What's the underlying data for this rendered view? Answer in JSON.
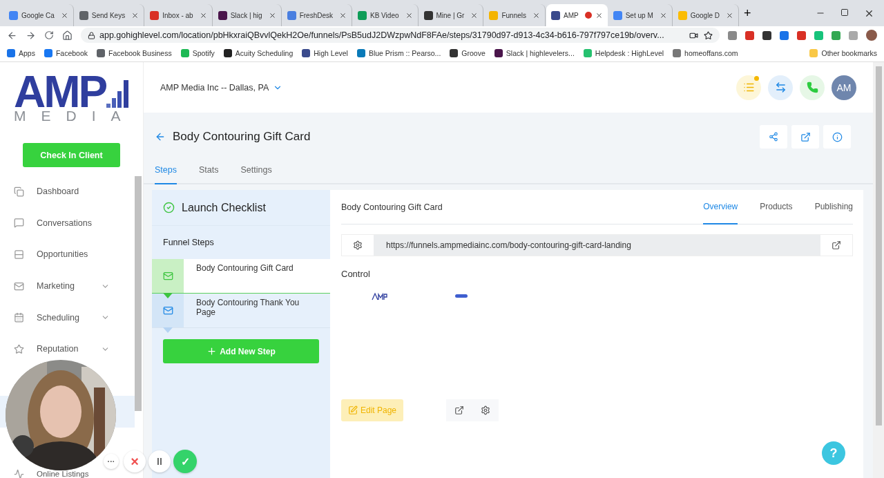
{
  "browser": {
    "tabs": [
      {
        "title": "Google Ca",
        "color": "#4285f4",
        "selected": false
      },
      {
        "title": "Send Keys",
        "color": "#5f6368",
        "selected": false
      },
      {
        "title": "Inbox - ab",
        "color": "#d93025",
        "selected": false
      },
      {
        "title": "Slack | hig",
        "color": "#4a154b",
        "selected": false
      },
      {
        "title": "FreshDesk",
        "color": "#4a7fe0",
        "selected": false
      },
      {
        "title": "KB Video",
        "color": "#0f9d58",
        "selected": false
      },
      {
        "title": "Mine | Gr",
        "color": "#333333",
        "selected": false
      },
      {
        "title": "Funnels",
        "color": "#f4b400",
        "selected": false
      },
      {
        "title": "AMP",
        "color": "#3a4a8c",
        "selected": true
      },
      {
        "title": "Set up M",
        "color": "#4285f4",
        "selected": false
      },
      {
        "title": "Google D",
        "color": "#fbbc04",
        "selected": false
      }
    ],
    "new_tab": "+",
    "url": "app.gohighlevel.com/location/pbHkxraiQBvvlQekH2Oe/funnels/PsB5udJ2DWzpwNdF8FAe/steps/31790d97-d913-4c34-b616-797f797ce19b/overv...",
    "bookmarks": [
      {
        "title": "Apps",
        "color": "#1a73e8"
      },
      {
        "title": "Facebook",
        "color": "#1877f2"
      },
      {
        "title": "Facebook Business",
        "color": "#5f6368"
      },
      {
        "title": "Spotify",
        "color": "#1db954"
      },
      {
        "title": "Acuity Scheduling",
        "color": "#222222"
      },
      {
        "title": "High Level",
        "color": "#3a4a8c"
      },
      {
        "title": "Blue Prism :: Pearso...",
        "color": "#0a7ab8"
      },
      {
        "title": "Groove",
        "color": "#333333"
      },
      {
        "title": "Slack | highlevelers...",
        "color": "#4a154b"
      },
      {
        "title": "Helpdesk : HighLevel",
        "color": "#25c16f"
      },
      {
        "title": "homeoffans.com",
        "color": "#777777"
      }
    ],
    "other_bookmarks": "Other bookmarks"
  },
  "logo": {
    "top": "AMP",
    "bottom": "MEDIA"
  },
  "check_in_button": "Check In Client",
  "sidebar": {
    "items": [
      {
        "label": "Dashboard",
        "expandable": false
      },
      {
        "label": "Conversations",
        "expandable": false
      },
      {
        "label": "Opportunities",
        "expandable": false
      },
      {
        "label": "Marketing",
        "expandable": true
      },
      {
        "label": "Scheduling",
        "expandable": true
      },
      {
        "label": "Reputation",
        "expandable": true
      }
    ],
    "bottom_item": "Online Listings"
  },
  "header": {
    "location": "AMP Media Inc -- Dallas, PA",
    "avatar": "AM"
  },
  "funnel": {
    "title": "Body Contouring Gift Card",
    "tabs": [
      {
        "label": "Steps",
        "selected": true
      },
      {
        "label": "Stats",
        "selected": false
      },
      {
        "label": "Settings",
        "selected": false
      }
    ],
    "checklist": "Launch Checklist",
    "steps_heading": "Funnel Steps",
    "steps": [
      {
        "name": "Body Contouring Gift Card",
        "selected": true
      },
      {
        "name": "Body Contouring Thank You Page",
        "selected": false
      }
    ],
    "add_step": "Add New Step"
  },
  "step_detail": {
    "title": "Body Contouring Gift Card",
    "tabs": [
      {
        "label": "Overview",
        "selected": true
      },
      {
        "label": "Products",
        "selected": false
      },
      {
        "label": "Publishing",
        "selected": false
      }
    ],
    "url": "https://funnels.ampmediainc.com/body-contouring-gift-card-landing",
    "variant": "Control",
    "edit_button": "Edit Page"
  },
  "recorder": {
    "more": "···",
    "cancel": "×",
    "pause": "II",
    "done": "✓"
  },
  "help": "?"
}
